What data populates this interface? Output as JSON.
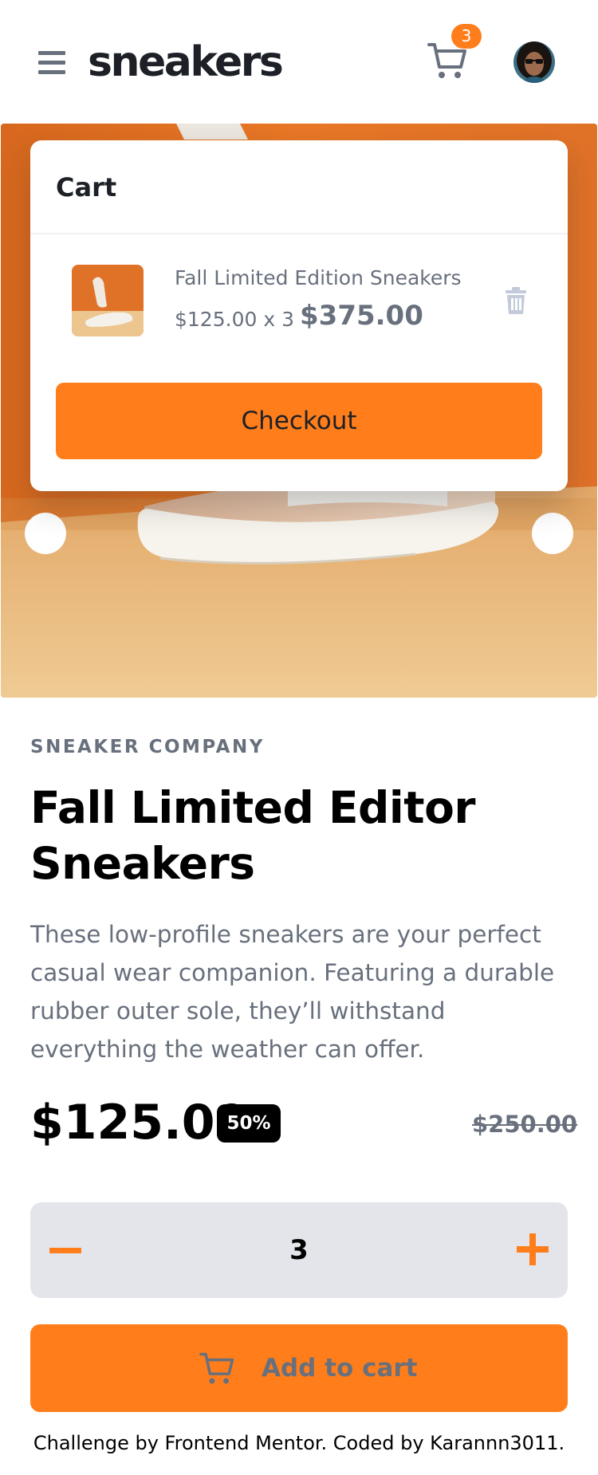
{
  "header": {
    "logo": "sneakers",
    "cart_count": "3",
    "menu_icon": "hamburger-menu-icon",
    "cart_icon": "cart-icon",
    "avatar": "user-avatar"
  },
  "cart": {
    "title": "Cart",
    "item": {
      "name": "Fall Limited Edition Sneakers",
      "unit_price_qty": "$125.00 x 3",
      "total": "$375.00",
      "delete_icon": "trash-icon"
    },
    "checkout_label": "Checkout"
  },
  "product": {
    "company": "SNEAKER COMPANY",
    "title": "Fall Limited Editor Sneakers",
    "description": "These low-profile sneakers are your perfect casual wear companion. Featuring a durable rubber outer sole, they’ll withstand everything the weather can offer.",
    "price": "$125.00",
    "discount": "50%",
    "old_price": "$250.00"
  },
  "quantity": {
    "value": "3",
    "minus_icon": "minus-icon",
    "plus_icon": "plus-icon"
  },
  "add_to_cart": {
    "label": "Add to cart",
    "icon": "cart-icon"
  },
  "footer": {
    "text": "Challenge by Frontend Mentor. Coded by Karannn3011."
  },
  "colors": {
    "accent": "#ff7e1b",
    "dark": "#1d2026",
    "grey": "#68707d",
    "light_grey": "#e3e5ea"
  }
}
